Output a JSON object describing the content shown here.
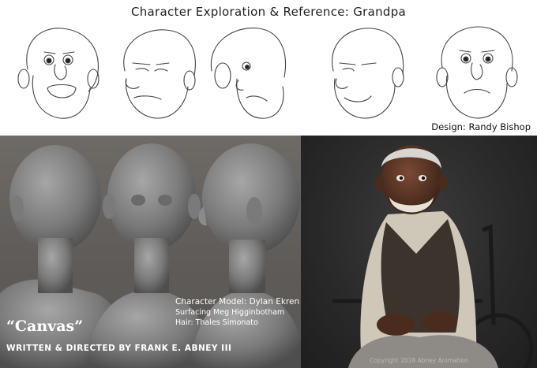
{
  "sketch": {
    "title": "Character Exploration & Reference: Grandpa",
    "design_credit": "Design: Randy Bishop"
  },
  "credits": {
    "model": "Character Model: Dylan Ekren",
    "surfacing": "Surfacing Meg Higginbotham",
    "hair": "Hair: Thales Simonato"
  },
  "film": {
    "title": "“Canvas”",
    "written_directed": "WRITTEN & DIRECTED BY FRANK E. ABNEY III"
  },
  "render": {
    "copyright": "Copyright 2018 Abney Animation"
  }
}
